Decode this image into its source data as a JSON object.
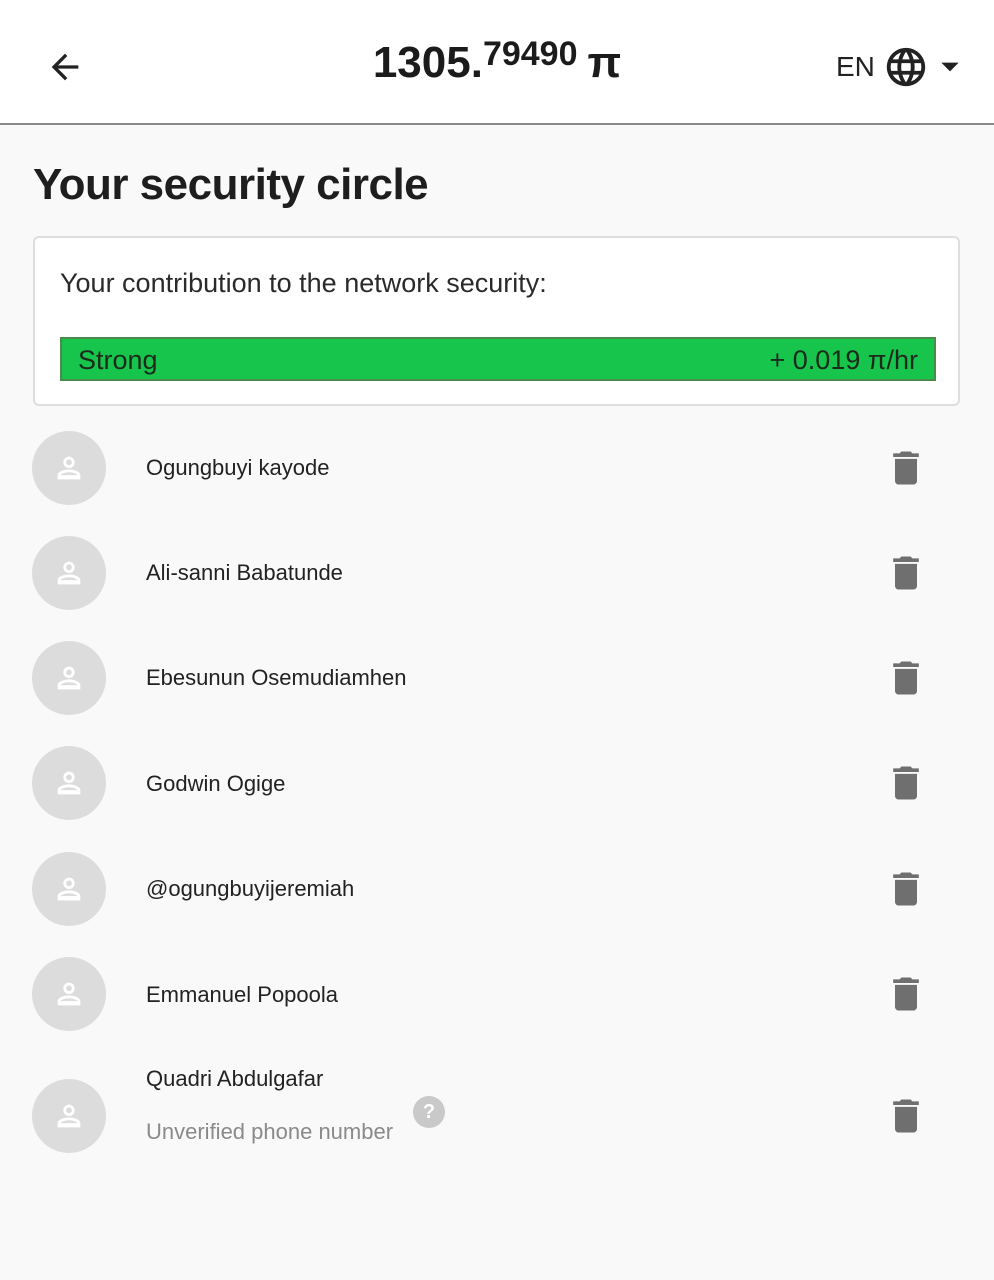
{
  "header": {
    "balance_int": "1305.",
    "balance_dec": "79490",
    "currency": "π",
    "language": "EN",
    "icons": {
      "back": "arrow-left-icon",
      "language": "globe-icon",
      "dropdown": "caret-down-icon"
    }
  },
  "page": {
    "title": "Your security circle"
  },
  "contribution": {
    "label": "Your contribution to the network security:",
    "level": "Strong",
    "rate": "+ 0.019 π/hr",
    "bar_color": "#17c54c"
  },
  "members": [
    {
      "name": "Ogungbuyi kayode"
    },
    {
      "name": "Ali-sanni Babatunde"
    },
    {
      "name": "Ebesunun Osemudiamhen"
    },
    {
      "name": "Godwin Ogige"
    },
    {
      "name": "@ogungbuyijeremiah"
    },
    {
      "name": "Emmanuel Popoola"
    },
    {
      "name": "Quadri Abdulgafar",
      "status": "Unverified phone number",
      "help": "?"
    }
  ],
  "member_icons": {
    "avatar": "user-icon",
    "delete": "trash-icon",
    "help": "question-icon"
  }
}
